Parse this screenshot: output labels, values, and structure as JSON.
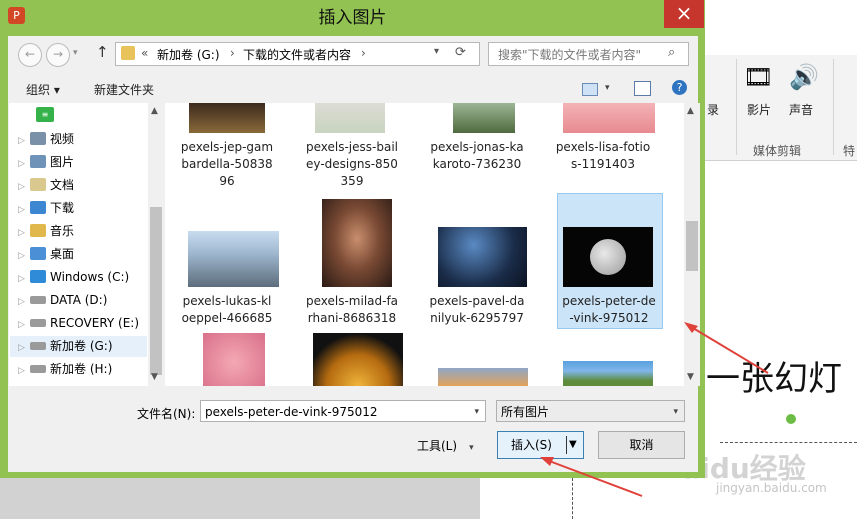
{
  "dialog": {
    "title": "插入图片",
    "close": "×",
    "nav": {
      "back": "←",
      "forward": "→",
      "up": "↑"
    },
    "address": {
      "prefix": "«",
      "crumbs": [
        "新加卷 (G:)",
        "下载的文件或者内容"
      ],
      "sep": "›"
    },
    "search_placeholder": "搜索\"下载的文件或者内容\"",
    "toolbar": {
      "organize": "组织 ▾",
      "new_folder": "新建文件夹",
      "help": "?"
    },
    "tree": [
      "视频",
      "图片",
      "文档",
      "下载",
      "音乐",
      "桌面",
      "Windows (C:)",
      "DATA (D:)",
      "RECOVERY (E:)",
      "新加卷 (G:)",
      "新加卷 (H:)"
    ],
    "files_row1": [
      [
        "pexels-jep-gam",
        "bardella-50838",
        "96"
      ],
      [
        "pexels-jess-bail",
        "ey-designs-850",
        "359"
      ],
      [
        "pexels-jonas-ka",
        "karoto-736230"
      ],
      [
        "pexels-lisa-fotio",
        "s-1191403"
      ]
    ],
    "files_row2": [
      [
        "pexels-lukas-kl",
        "oeppel-466685"
      ],
      [
        "pexels-milad-fa",
        "rhani-8686318"
      ],
      [
        "pexels-pavel-da",
        "nilyuk-6295797"
      ],
      [
        "pexels-peter-de",
        "-vink-975012"
      ]
    ],
    "filename_label": "文件名(N):",
    "filename_value": "pexels-peter-de-vink-975012",
    "filter_value": "所有图片",
    "tools": "工具(L)",
    "insert": "插入(S)",
    "cancel": "取消"
  },
  "background": {
    "ribbon_movie": "影片",
    "ribbon_sound": "声音",
    "ribbon_group": "媒体剪辑",
    "ribbon_cut": "特",
    "ribbon_misc": "录",
    "slide_text": "一张幻灯",
    "watermark": "Baidu经验",
    "watermark_url": "jingyan.baidu.com"
  },
  "colors": {
    "dialog_frame": "#92c352",
    "close": "#c7362c",
    "selection": "#cce4f7",
    "annotation_arrow": "#e0413a"
  }
}
